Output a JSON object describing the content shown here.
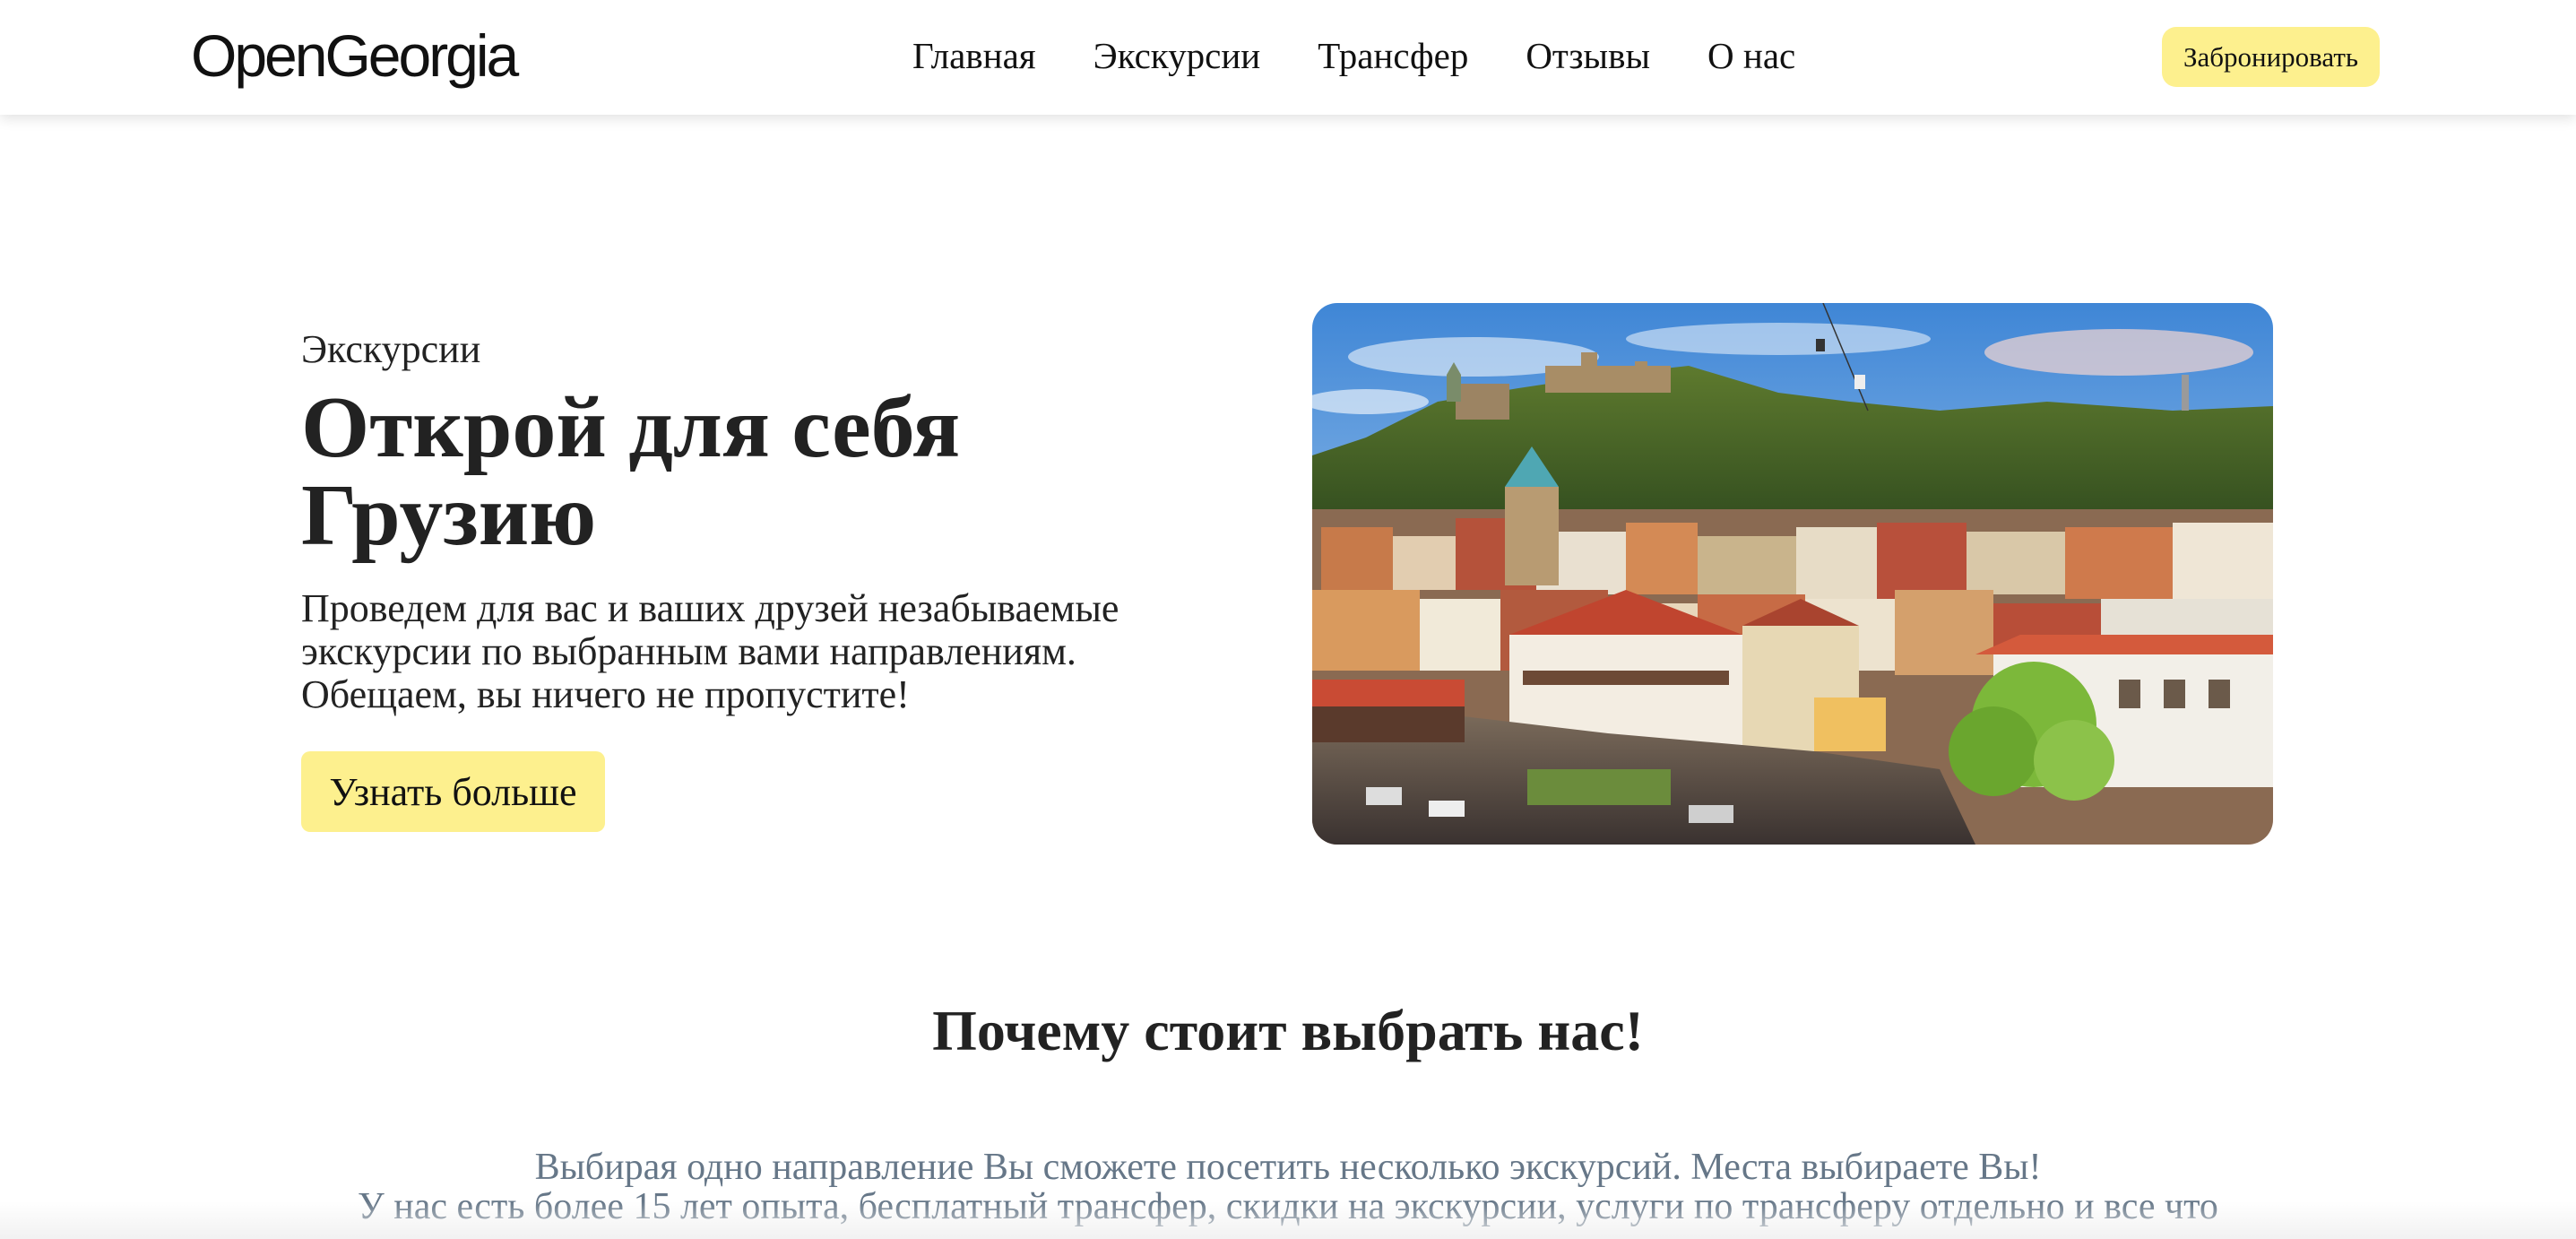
{
  "header": {
    "logo": "OpenGeorgia",
    "nav": [
      "Главная",
      "Экскурсии",
      "Трансфер",
      "Отзывы",
      "О нас"
    ],
    "book_button": "Забронировать"
  },
  "hero": {
    "eyebrow": "Экскурсии",
    "title_line1": "Открой для себя",
    "title_line2": "Грузию",
    "text_line1": "Проведем для вас и ваших друзей незабываемые",
    "text_line2": "экскурсии по выбранным вами направлениям.",
    "text_line3": "Обещаем, вы ничего не пропустите!",
    "button": "Узнать больше",
    "image_alt": "Old Tbilisi panorama"
  },
  "why": {
    "title": "Почему стоит выбрать нас!",
    "line1": "Выбирая одно направление Вы сможете посетить несколько экскурсий. Места выбираете Вы!",
    "line2": "У нас есть более 15 лет опыта, бесплатный трансфер, скидки на экскурсии, услуги по трансферу отдельно и все что"
  },
  "colors": {
    "accent": "#fdf08e",
    "text": "#222222",
    "muted_text": "#667788"
  }
}
